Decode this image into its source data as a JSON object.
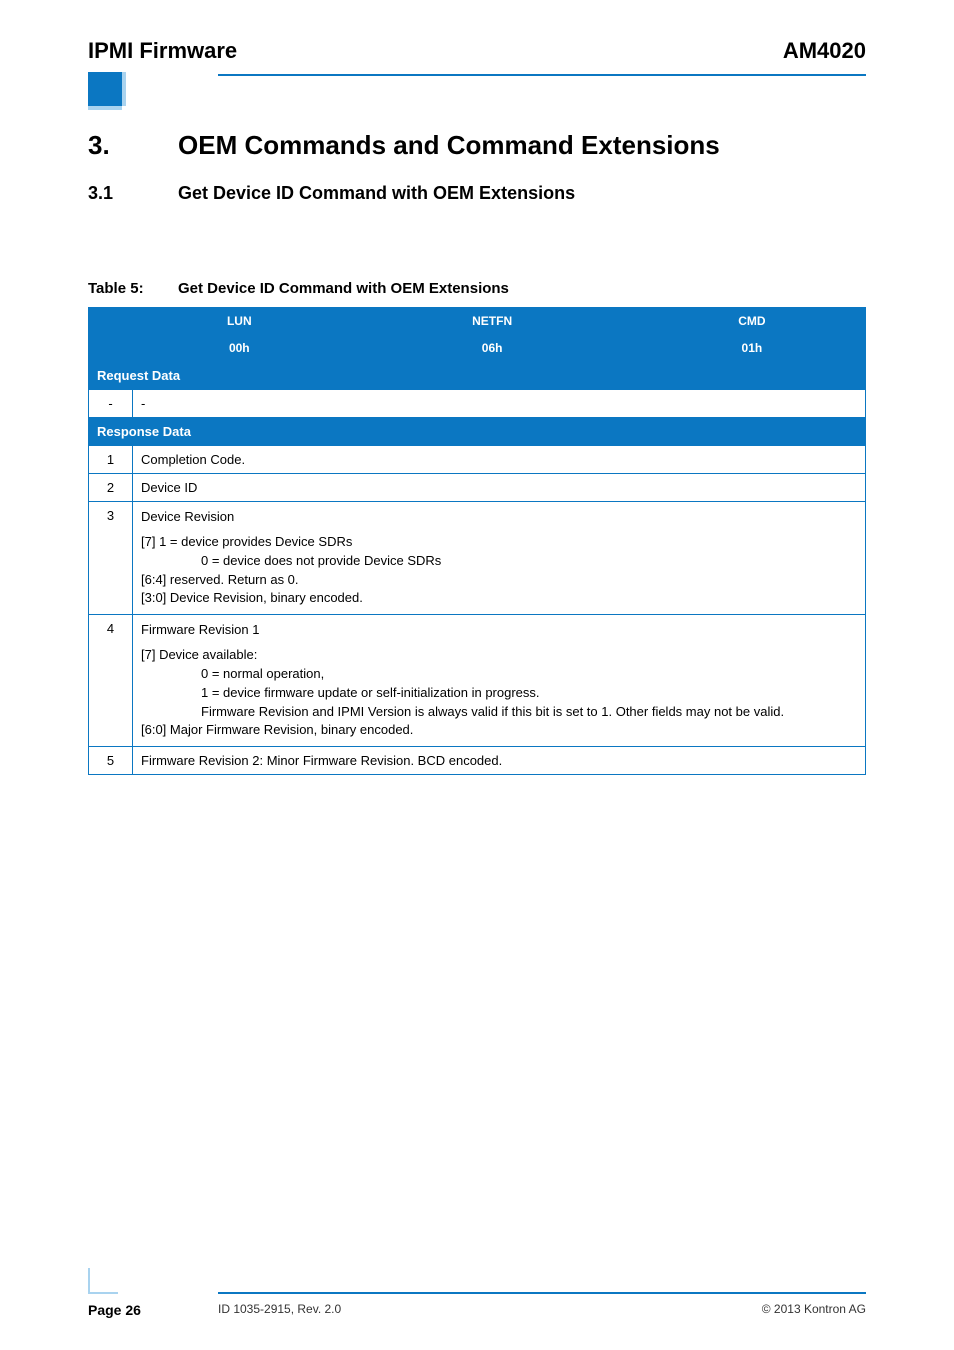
{
  "header": {
    "left": "IPMI Firmware",
    "right": "AM4020"
  },
  "section": {
    "number": "3.",
    "title": "OEM Commands and Command Extensions"
  },
  "subsection": {
    "number": "3.1",
    "title": "Get Device ID Command with OEM Extensions"
  },
  "table": {
    "caption_label": "Table 5:",
    "caption_text": "Get Device ID Command with OEM Extensions",
    "head": {
      "c1": "LUN",
      "c2": "NETFN",
      "c3": "CMD",
      "v1": "00h",
      "v2": "06h",
      "v3": "01h"
    },
    "req_label": "Request Data",
    "req_row": {
      "num": "-",
      "text": "-"
    },
    "resp_label": "Response Data",
    "rows": [
      {
        "num": "1",
        "text": "Completion Code."
      },
      {
        "num": "2",
        "text": "Device ID"
      },
      {
        "num": "3",
        "lines": [
          "Device Revision",
          "[7] 1 = device provides Device SDRs",
          "0 = device does not provide Device SDRs",
          "[6:4] reserved. Return as 0.",
          "[3:0] Device Revision, binary encoded."
        ]
      },
      {
        "num": "4",
        "lines": [
          "Firmware Revision 1",
          "[7] Device available:",
          "0 = normal operation,",
          "1 = device firmware update or self-initialization in progress.",
          "Firmware Revision and IPMI Version is always valid if this bit is set to 1. Other fields may not be valid.",
          "[6:0] Major Firmware Revision, binary encoded."
        ]
      },
      {
        "num": "5",
        "text": "Firmware Revision 2: Minor Firmware Revision. BCD encoded."
      }
    ]
  },
  "footer": {
    "page": "Page 26",
    "id": "ID 1035-2915, Rev. 2.0",
    "copyright": "© 2013 Kontron AG"
  }
}
